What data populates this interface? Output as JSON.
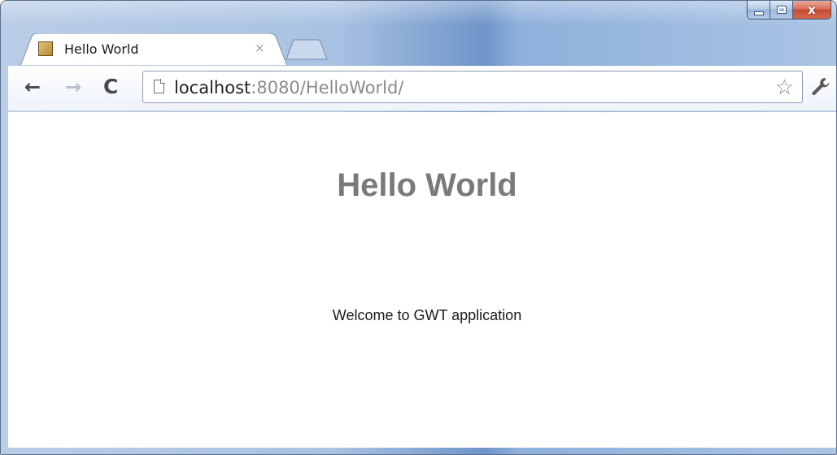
{
  "window": {
    "controls": {
      "minimize": "minimize-icon",
      "maximize": "maximize-icon",
      "close_glyph": "x"
    }
  },
  "tabs": [
    {
      "title": "Hello World",
      "close_glyph": "×",
      "favicon": "gwt-favicon-icon"
    }
  ],
  "toolbar": {
    "back_glyph": "←",
    "forward_glyph": "→",
    "reload_glyph": "C",
    "url_host": "localhost",
    "url_rest": ":8080/HelloWorld/",
    "star_glyph": "☆"
  },
  "page": {
    "heading": "Hello World",
    "welcome_text": "Welcome to GWT application"
  },
  "colors": {
    "frame": "#a9c2e2",
    "close_button": "#c24a2f",
    "heading": "#7a7a7a"
  }
}
